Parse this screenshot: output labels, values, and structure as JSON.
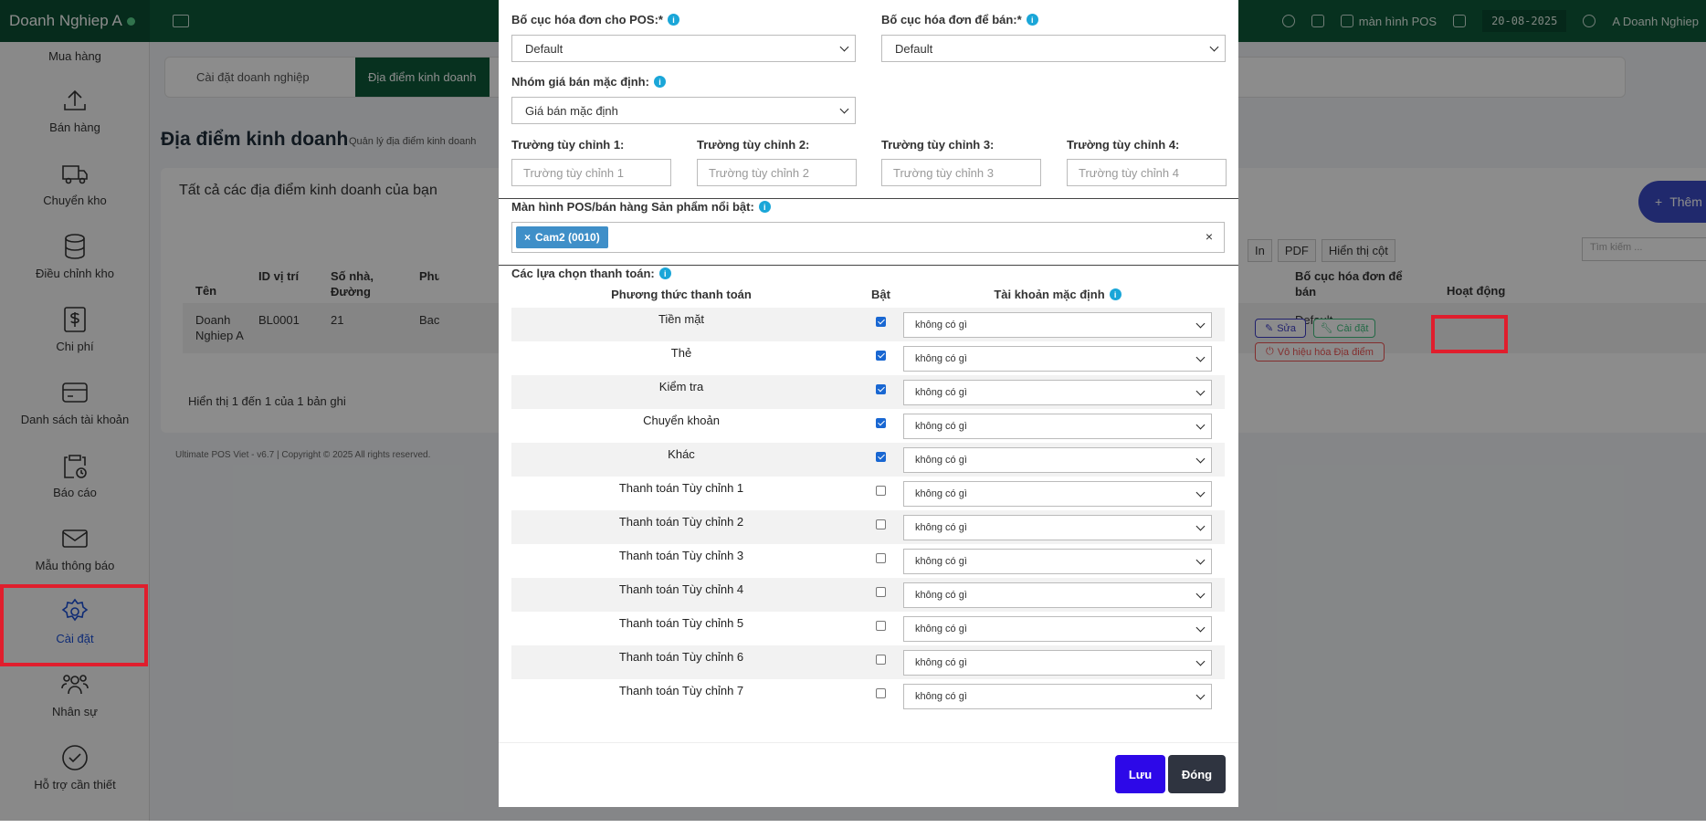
{
  "topbar": {
    "business": "Doanh Nghiep A",
    "pos_label": "màn hình POS",
    "date": "20-08-2025",
    "user": "A Doanh Nghiep"
  },
  "sidebar": {
    "items": [
      {
        "label": "Mua hàng",
        "icon": "shopping-icon"
      },
      {
        "label": "Bán hàng",
        "icon": "upload-icon"
      },
      {
        "label": "Chuyển kho",
        "icon": "truck-icon"
      },
      {
        "label": "Điều chỉnh kho",
        "icon": "database-icon"
      },
      {
        "label": "Chi phí",
        "icon": "dollar-icon"
      },
      {
        "label": "Danh sách tài khoản",
        "icon": "card-icon"
      },
      {
        "label": "Báo cáo",
        "icon": "clipboard-icon"
      },
      {
        "label": "Mẫu thông báo",
        "icon": "envelope-icon"
      },
      {
        "label": "Cài đặt",
        "icon": "gear-icon"
      },
      {
        "label": "Nhân sự",
        "icon": "users-icon"
      },
      {
        "label": "Hỗ trợ cần thiết",
        "icon": "check-circle-icon"
      }
    ],
    "active_index": 8
  },
  "background": {
    "tabs": [
      "Cài đặt doanh nghiệp",
      "Địa điểm kinh doanh"
    ],
    "page_title": "Địa điểm kinh doanh",
    "page_subtitle": "Quản lý địa điểm kinh doanh",
    "card_title": "Tất cả các địa điểm kinh doanh của bạn",
    "add_label": "Thêm",
    "tools": [
      "In",
      "PDF",
      "Hiển thị cột"
    ],
    "search_placeholder": "Tìm kiếm ...",
    "columns": {
      "name": "Tên",
      "location_id": "ID vị trí",
      "address": "Số nhà, Đường",
      "ward": "Phường Trấn",
      "col_p": "P",
      "sale_layout": "Bố cục hóa đơn để bán",
      "actions": "Hoạt động"
    },
    "row": {
      "name": "Doanh Nghiep A",
      "location_id": "BL0001",
      "address": "21",
      "ward": "Bac",
      "sale_layout": "Default"
    },
    "actions": {
      "edit": "Sửa",
      "settings": "Cài đặt",
      "disable": "Vô hiệu hóa Địa điểm"
    },
    "showing": "Hiển thị 1 đến 1 của 1 bản ghi",
    "footer": "Ultimate POS Viet - v6.7 | Copyright © 2025 All rights reserved."
  },
  "modal": {
    "pos_layout_label": "Bố cục hóa đơn cho POS:*",
    "pos_layout_value": "Default",
    "sale_layout_label": "Bố cục hóa đơn để bán:*",
    "sale_layout_value": "Default",
    "price_group_label": "Nhóm giá bán mặc định:",
    "price_group_value": "Giá bán mặc định",
    "custom_fields": [
      {
        "label": "Trường tùy chỉnh 1:",
        "placeholder": "Trường tùy chỉnh 1"
      },
      {
        "label": "Trường tùy chỉnh 2:",
        "placeholder": "Trường tùy chỉnh 2"
      },
      {
        "label": "Trường tùy chỉnh 3:",
        "placeholder": "Trường tùy chỉnh 3"
      },
      {
        "label": "Trường tùy chỉnh 4:",
        "placeholder": "Trường tùy chỉnh 4"
      }
    ],
    "featured_label": "Màn hình POS/bán hàng Sản phẩm nổi bật:",
    "featured_tag": "Cam2 (0010)",
    "payment_label": "Các lựa chọn thanh toán:",
    "payment_headers": {
      "method": "Phương thức thanh toán",
      "enabled": "Bật",
      "account": "Tài khoản mặc định"
    },
    "payments": [
      {
        "name": "Tiền mặt",
        "enabled": true,
        "account": "không có gì"
      },
      {
        "name": "Thẻ",
        "enabled": true,
        "account": "không có gì"
      },
      {
        "name": "Kiểm tra",
        "enabled": true,
        "account": "không có gì"
      },
      {
        "name": "Chuyển khoản",
        "enabled": true,
        "account": "không có gì"
      },
      {
        "name": "Khác",
        "enabled": true,
        "account": "không có gì"
      },
      {
        "name": "Thanh toán Tùy chỉnh 1",
        "enabled": false,
        "account": "không có gì"
      },
      {
        "name": "Thanh toán Tùy chỉnh 2",
        "enabled": false,
        "account": "không có gì"
      },
      {
        "name": "Thanh toán Tùy chỉnh 3",
        "enabled": false,
        "account": "không có gì"
      },
      {
        "name": "Thanh toán Tùy chỉnh 4",
        "enabled": false,
        "account": "không có gì"
      },
      {
        "name": "Thanh toán Tùy chỉnh 5",
        "enabled": false,
        "account": "không có gì"
      },
      {
        "name": "Thanh toán Tùy chỉnh 6",
        "enabled": false,
        "account": "không có gì"
      },
      {
        "name": "Thanh toán Tùy chỉnh 7",
        "enabled": false,
        "account": "không có gì"
      }
    ],
    "save_label": "Lưu",
    "close_label": "Đóng"
  },
  "colors": {
    "topbar": "#0e5a3a",
    "highlight": "#e01e2d",
    "save": "#2d08e8",
    "close": "#2f3440"
  }
}
